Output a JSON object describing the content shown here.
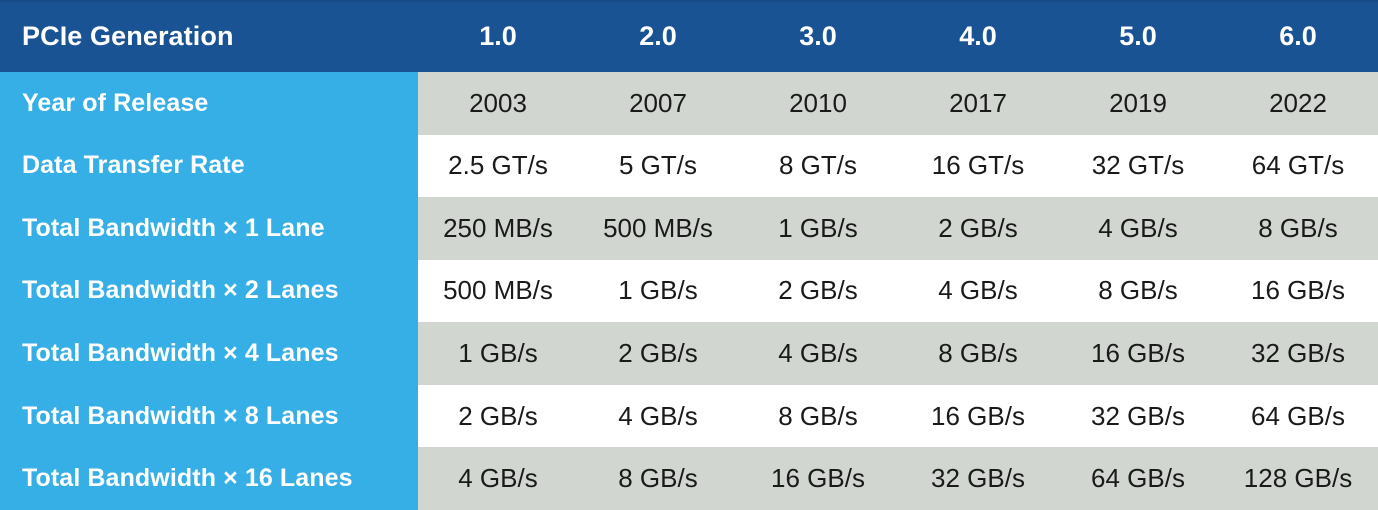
{
  "table": {
    "header": {
      "label": "PCIe Generation",
      "generations": [
        "1.0",
        "2.0",
        "3.0",
        "4.0",
        "5.0",
        "6.0"
      ]
    },
    "rows": [
      {
        "label": "Year of Release",
        "band": "gray",
        "values": [
          "2003",
          "2007",
          "2010",
          "2017",
          "2019",
          "2022"
        ]
      },
      {
        "label": "Data Transfer Rate",
        "band": "white",
        "values": [
          "2.5 GT/s",
          "5 GT/s",
          "8 GT/s",
          "16 GT/s",
          "32 GT/s",
          "64 GT/s"
        ]
      },
      {
        "label": "Total Bandwidth × 1 Lane",
        "band": "gray",
        "values": [
          "250 MB/s",
          "500 MB/s",
          "1 GB/s",
          "2 GB/s",
          "4 GB/s",
          "8 GB/s"
        ]
      },
      {
        "label": "Total Bandwidth × 2 Lanes",
        "band": "white",
        "values": [
          "500 MB/s",
          "1 GB/s",
          "2 GB/s",
          "4 GB/s",
          "8 GB/s",
          "16 GB/s"
        ]
      },
      {
        "label": "Total Bandwidth × 4 Lanes",
        "band": "gray",
        "values": [
          "1 GB/s",
          "2 GB/s",
          "4 GB/s",
          "8 GB/s",
          "16 GB/s",
          "32 GB/s"
        ]
      },
      {
        "label": "Total Bandwidth × 8 Lanes",
        "band": "white",
        "values": [
          "2 GB/s",
          "4 GB/s",
          "8 GB/s",
          "16 GB/s",
          "32 GB/s",
          "64 GB/s"
        ]
      },
      {
        "label": "Total Bandwidth × 16 Lanes",
        "band": "gray",
        "values": [
          "4 GB/s",
          "8 GB/s",
          "16 GB/s",
          "32 GB/s",
          "64 GB/s",
          "128 GB/s"
        ]
      }
    ]
  },
  "colors": {
    "header_blue": "#1A5394",
    "header_blue_top_edge": "#164A86",
    "label_blue": "#36AEE6",
    "band_gray": "#D2D6D1",
    "band_white": "#FFFFFF",
    "header_text": "#FFFFFF",
    "label_text": "#FFFFFF",
    "value_text": "#1A1A1A"
  }
}
